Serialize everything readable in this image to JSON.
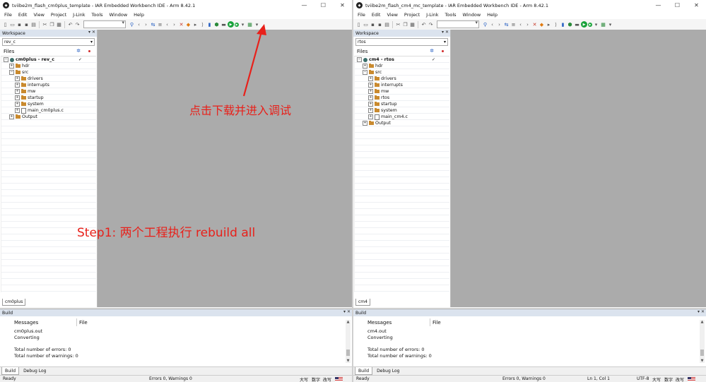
{
  "windows": [
    {
      "id": "left",
      "title": "tviibe2m_flash_cm0plus_template - IAR Embedded Workbench IDE - Arm 8.42.1",
      "menu": [
        "File",
        "Edit",
        "View",
        "Project",
        "J-Link",
        "Tools",
        "Window",
        "Help"
      ],
      "workspace": {
        "header": "Workspace",
        "config": "rev_c",
        "files_label": "Files",
        "project": "cm0plus - rev_c",
        "tree": [
          {
            "label": "hdr",
            "indent": 1,
            "kind": "folder",
            "exp": "+"
          },
          {
            "label": "src",
            "indent": 1,
            "kind": "folder",
            "exp": "-"
          },
          {
            "label": "drivers",
            "indent": 2,
            "kind": "folder",
            "exp": "+"
          },
          {
            "label": "interrupts",
            "indent": 2,
            "kind": "folder",
            "exp": "+"
          },
          {
            "label": "mw",
            "indent": 2,
            "kind": "folder",
            "exp": "+"
          },
          {
            "label": "startup",
            "indent": 2,
            "kind": "folder",
            "exp": "+"
          },
          {
            "label": "system",
            "indent": 2,
            "kind": "folder",
            "exp": "+"
          },
          {
            "label": "main_cm0plus.c",
            "indent": 2,
            "kind": "file",
            "exp": "+"
          },
          {
            "label": "Output",
            "indent": 1,
            "kind": "folder",
            "exp": "+"
          }
        ],
        "tab": "cm0plus"
      },
      "build": {
        "header": "Build",
        "col_messages": "Messages",
        "col_file": "File",
        "lines": [
          "cm0plus.out",
          "Converting",
          "",
          "Total number of errors: 0",
          "Total number of warnings: 0"
        ],
        "tabs": [
          "Build",
          "Debug Log"
        ]
      },
      "status": {
        "left": "Ready",
        "mid": "Errors 0, Warnings 0",
        "ime1": "大写",
        "ime2": "数字",
        "ime3": "改写"
      }
    },
    {
      "id": "right",
      "title": "tviibe2m_flash_cm4_mc_template - IAR Embedded Workbench IDE - Arm 8.42.1",
      "menu": [
        "File",
        "Edit",
        "View",
        "Project",
        "J-Link",
        "Tools",
        "Window",
        "Help"
      ],
      "workspace": {
        "header": "Workspace",
        "config": "rtos",
        "files_label": "Files",
        "project": "cm4 - rtos",
        "tree": [
          {
            "label": "hdr",
            "indent": 1,
            "kind": "folder",
            "exp": "+"
          },
          {
            "label": "src",
            "indent": 1,
            "kind": "folder",
            "exp": "-"
          },
          {
            "label": "drivers",
            "indent": 2,
            "kind": "folder",
            "exp": "+"
          },
          {
            "label": "interrupts",
            "indent": 2,
            "kind": "folder",
            "exp": "+"
          },
          {
            "label": "mw",
            "indent": 2,
            "kind": "folder",
            "exp": "+"
          },
          {
            "label": "rtos",
            "indent": 2,
            "kind": "folder",
            "exp": "+"
          },
          {
            "label": "startup",
            "indent": 2,
            "kind": "folder",
            "exp": "+"
          },
          {
            "label": "system",
            "indent": 2,
            "kind": "folder",
            "exp": "+"
          },
          {
            "label": "main_cm4.c",
            "indent": 2,
            "kind": "file",
            "exp": "+"
          },
          {
            "label": "Output",
            "indent": 1,
            "kind": "folder",
            "exp": "+"
          }
        ],
        "tab": "cm4"
      },
      "build": {
        "header": "Build",
        "col_messages": "Messages",
        "col_file": "File",
        "lines": [
          "cm4.out",
          "Converting",
          "",
          "Total number of errors: 0",
          "Total number of warnings: 0"
        ],
        "tabs": [
          "Build",
          "Debug Log"
        ]
      },
      "status": {
        "left": "Ready",
        "mid": "Errors 0, Warnings 0",
        "pos": "Ln 1, Col 1",
        "enc": "UTF-8",
        "ime1": "大写",
        "ime2": "数字",
        "ime3": "改写"
      }
    }
  ],
  "annotations": {
    "step1": "Step1: 两个工程执行 rebuild all",
    "download": "点击下载并进入调试"
  },
  "colors": {
    "annotation": "#e8201a",
    "editor_bg": "#ababab",
    "panel_header": "#dbe3ee"
  }
}
